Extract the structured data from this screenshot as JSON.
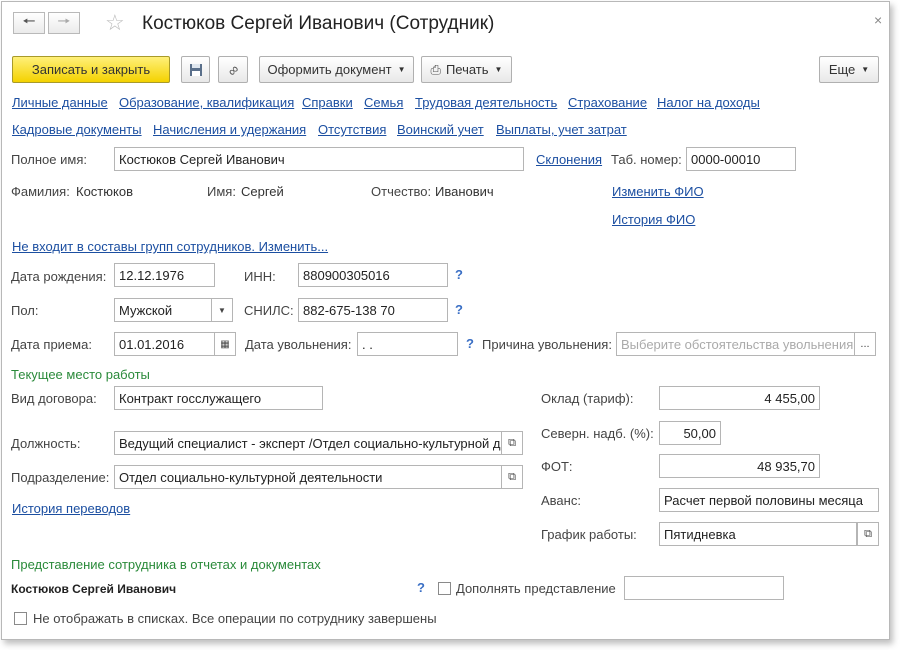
{
  "window": {
    "title": "Костюков Сергей Иванович (Сотрудник)"
  },
  "toolbar": {
    "save_close": "Записать и закрыть",
    "make_doc": "Оформить документ",
    "print": "Печать",
    "more": "Еще"
  },
  "links_row1": [
    "Личные данные",
    "Образование, квалификация",
    "Справки",
    "Семья",
    "Трудовая деятельность",
    "Страхование",
    "Налог на доходы"
  ],
  "links_row2": [
    "Кадровые документы",
    "Начисления и удержания",
    "Отсутствия",
    "Воинский учет",
    "Выплаты, учет затрат"
  ],
  "fullname": {
    "label": "Полное имя:",
    "value": "Костюков Сергей Иванович",
    "declension_link": "Склонения"
  },
  "tab": {
    "label": "Таб. номер:",
    "value": "0000-00010"
  },
  "surname": {
    "label": "Фамилия:",
    "value": "Костюков"
  },
  "name": {
    "label": "Имя:",
    "value": "Сергей"
  },
  "patronymic": {
    "label": "Отчество:",
    "value": "Иванович"
  },
  "change_fio": "Изменить ФИО",
  "history_fio": "История ФИО",
  "groups_link": "Не входит в составы групп сотрудников. Изменить...",
  "birth": {
    "label": "Дата рождения:",
    "value": "12.12.1976"
  },
  "inn": {
    "label": "ИНН:",
    "value": "880900305016"
  },
  "gender": {
    "label": "Пол:",
    "value": "Мужской"
  },
  "snils": {
    "label": "СНИЛС:",
    "value": "882-675-138 70"
  },
  "hire": {
    "label": "Дата приема:",
    "value": "01.01.2016"
  },
  "dismiss": {
    "label": "Дата увольнения:",
    "value": " .  ."
  },
  "dismiss_reason": {
    "label": "Причина увольнения:",
    "placeholder": "Выберите обстоятельства увольнения"
  },
  "workplace_section": "Текущее место работы",
  "contract": {
    "label": "Вид договора:",
    "value": "Контракт госслужащего"
  },
  "position": {
    "label": "Должность:",
    "value": "Ведущий специалист - эксперт /Отдел социально-культурной д"
  },
  "department": {
    "label": "Подразделение:",
    "value": "Отдел социально-культурной деятельности"
  },
  "transfer_history": "История переводов",
  "salary": {
    "label": "Оклад (тариф):",
    "value": "4 455,00"
  },
  "north": {
    "label": "Северн. надб. (%):",
    "value": "50,00"
  },
  "fot": {
    "label": "ФОТ:",
    "value": "48 935,70"
  },
  "advance": {
    "label": "Аванс:",
    "value": "Расчет первой половины месяца"
  },
  "schedule": {
    "label": "График работы:",
    "value": "Пятидневка"
  },
  "presentation_section": "Представление сотрудника в отчетах и документах",
  "presentation_name": "Костюков Сергей Иванович",
  "supplement": {
    "label": "Дополнять представление",
    "value": ""
  },
  "hide_list": "Не отображать в списках. Все операции по сотруднику завершены",
  "help_mark": "?"
}
